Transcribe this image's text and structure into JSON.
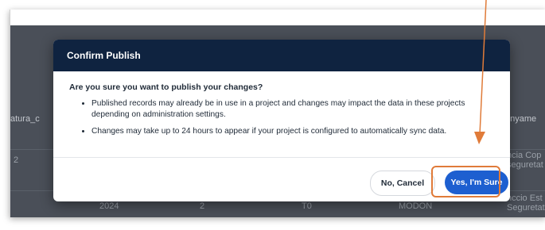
{
  "background": {
    "left_header": "atura_c",
    "right_header": "enyame",
    "left_cell": "2",
    "right_cell_1": "ncia Cop",
    "right_cell_2": "seguretat",
    "row2": {
      "year": "2024",
      "num": "2",
      "code": "T0",
      "status": "MODON",
      "right_1": "nccio Est",
      "right_2": "Seguretat"
    }
  },
  "dialog": {
    "title": "Confirm Publish",
    "question": "Are you sure you want to publish your changes?",
    "bullets": [
      "Published records may already be in use in a project and changes may impact the data in these projects depending on administration settings.",
      "Changes may take up to 24 hours to appear if your project is configured to automatically sync data."
    ],
    "cancel_label": "No, Cancel",
    "confirm_label": "Yes, I'm Sure"
  },
  "colors": {
    "header": "#0f2340",
    "confirm_button": "#1d5fd0",
    "annotation": "#e07b39",
    "backdrop": "#4a4f58"
  }
}
